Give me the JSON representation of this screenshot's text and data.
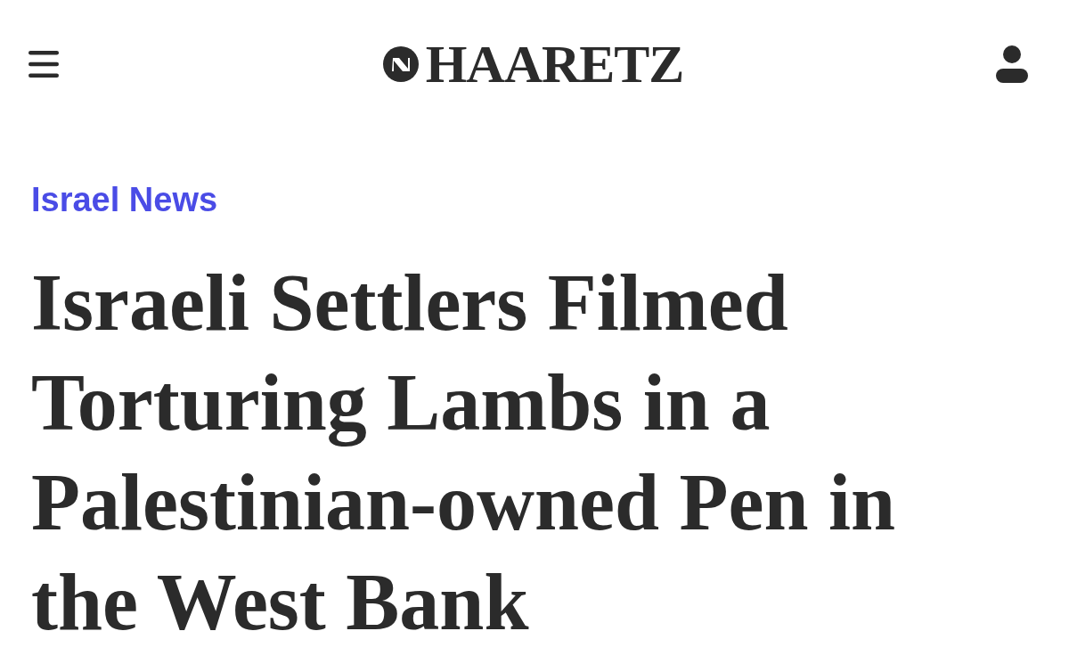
{
  "header": {
    "logo_text": "HAARETZ"
  },
  "article": {
    "section": "Israel News",
    "headline": "Israeli Settlers Filmed Torturing Lambs in a Palestinian-owned Pen in the West Bank"
  }
}
